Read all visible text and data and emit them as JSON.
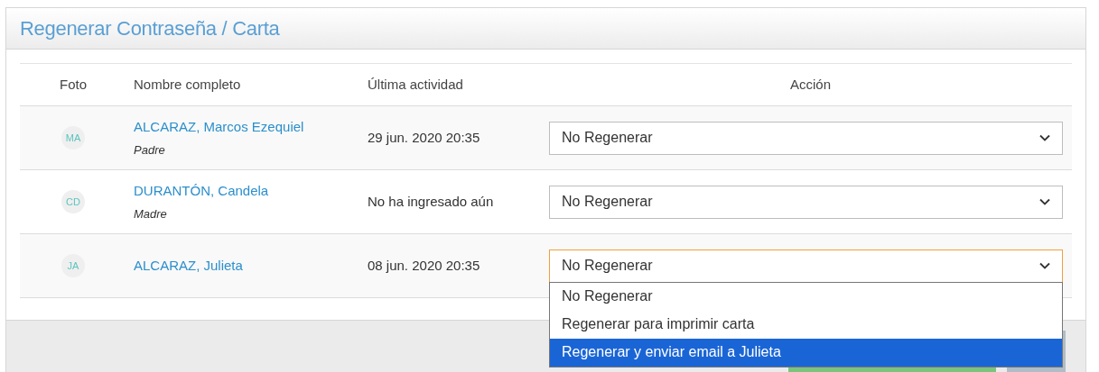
{
  "modal": {
    "title": "Regenerar Contraseña / Carta"
  },
  "table": {
    "columns": [
      "Foto",
      "Nombre completo",
      "Última actividad",
      "Acción"
    ],
    "rows": [
      {
        "initials": "MA",
        "name": "ALCARAZ, Marcos Ezequiel",
        "role": "Padre",
        "last_activity": "29 jun. 2020 20:35",
        "action": "No Regenerar",
        "focused": false
      },
      {
        "initials": "CD",
        "name": "DURANTÓN, Candela",
        "role": "Madre",
        "last_activity": "No ha ingresado aún",
        "action": "No Regenerar",
        "focused": false
      },
      {
        "initials": "JA",
        "name": "ALCARAZ, Julieta",
        "last_activity": "08 jun. 2020 20:35",
        "action": "No Regenerar",
        "focused": true
      }
    ]
  },
  "dropdown": {
    "options": [
      {
        "label": "No Regenerar",
        "selected": false
      },
      {
        "label": "Regenerar para imprimir carta",
        "selected": false
      },
      {
        "label": "Regenerar y enviar email a Julieta",
        "selected": true
      }
    ]
  }
}
